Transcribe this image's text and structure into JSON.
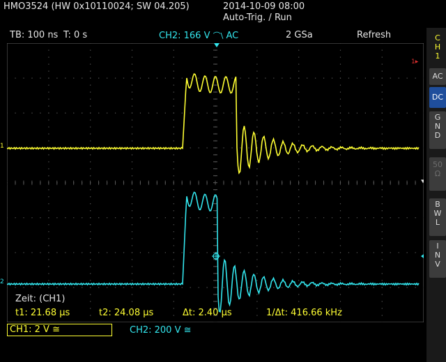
{
  "header": {
    "model": "HMO3524 (HW 0x10110024; SW 04.205)",
    "datetime": "2014-10-09 08:00",
    "status": "Auto-Trig. / Run"
  },
  "info_bar": {
    "timebase": "TB: 100 ns",
    "trigger_time": "T: 0 s",
    "trigger_source": "CH2: 166 V",
    "trigger_slope": "⌒\\",
    "trigger_coupling": "AC",
    "sample_rate": "2 GSa",
    "acq_mode": "Refresh"
  },
  "sidebar": {
    "channel": [
      "C",
      "H",
      "1"
    ],
    "buttons": [
      {
        "label": [
          "AC"
        ]
      },
      {
        "label": [
          "DC"
        ]
      },
      {
        "label": [
          "G",
          "N",
          "D"
        ]
      },
      {
        "label": [
          "50",
          "Ω"
        ]
      },
      {
        "label": [
          "B",
          "W",
          "L"
        ]
      },
      {
        "label": [
          "I",
          "N",
          "V"
        ]
      }
    ]
  },
  "markers": {
    "ch1": "1",
    "ch2": "2",
    "trigger_level": "1▸"
  },
  "cursor_panel": {
    "title": "Zeit: (CH1)",
    "t1": "t1: 21.68 µs",
    "t2": "t2: 24.08 µs",
    "dt": "Δt: 2.40 µs",
    "freq": "1/Δt: 416.66 kHz"
  },
  "channels": {
    "ch1": "CH1: 2 V ≅",
    "ch2": "CH2: 200 V ≅"
  },
  "colors": {
    "ch1": "#ffff33",
    "ch2": "#33e6ee",
    "grid": "#5a5a5a",
    "trigger": "#e03030",
    "sidebar_active": "#1f4e9c"
  }
}
